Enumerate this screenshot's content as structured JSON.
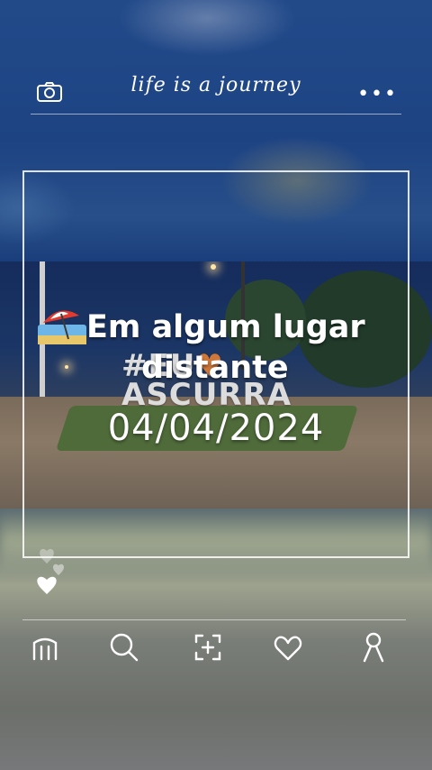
{
  "header": {
    "title": "life is a journey",
    "left_icon": "camera-icon",
    "right_icon": "more-dots-icon",
    "more_label": "•••"
  },
  "post": {
    "caption_line1": "Em algum lugar",
    "caption_line2": "distante",
    "caption_emoji": "beach-umbrella-emoji",
    "date": "04/04/2024",
    "photo_sign_line1": "#EU",
    "photo_sign_line2": "ASCURRA"
  },
  "reactions": {
    "icons": [
      "heart-icon",
      "heart-icon",
      "heart-icon"
    ]
  },
  "bottom_nav": {
    "items": [
      {
        "icon": "home-icon"
      },
      {
        "icon": "search-icon"
      },
      {
        "icon": "add-post-icon"
      },
      {
        "icon": "heart-icon"
      },
      {
        "icon": "profile-icon"
      }
    ]
  },
  "colors": {
    "accent": "#ffffff",
    "sign_heart": "#d0783a"
  }
}
